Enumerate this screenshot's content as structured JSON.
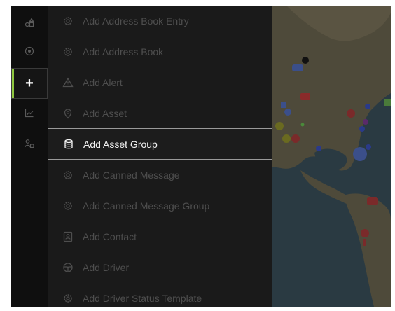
{
  "menu": {
    "items": [
      {
        "label": "Add Address Book Entry",
        "icon": "gear-icon"
      },
      {
        "label": "Add Address Book",
        "icon": "gear-icon"
      },
      {
        "label": "Add Alert",
        "icon": "warning-icon"
      },
      {
        "label": "Add Asset",
        "icon": "location-pin-icon"
      },
      {
        "label": "Add Asset Group",
        "icon": "database-icon"
      },
      {
        "label": "Add Canned Message",
        "icon": "gear-icon"
      },
      {
        "label": "Add Canned Message Group",
        "icon": "gear-icon"
      },
      {
        "label": "Add Contact",
        "icon": "contact-card-icon"
      },
      {
        "label": "Add Driver",
        "icon": "steering-wheel-icon"
      },
      {
        "label": "Add Driver Status Template",
        "icon": "gear-icon"
      }
    ],
    "selected_index": 4
  },
  "rail": {
    "items": [
      "shapes-icon",
      "target-icon",
      "plus-icon",
      "chart-icon",
      "users-icon"
    ],
    "active_index": 2
  },
  "colors": {
    "accent": "#8dc63f",
    "menu_bg": "#1a1a1a",
    "rail_bg": "#0f0f0f"
  }
}
